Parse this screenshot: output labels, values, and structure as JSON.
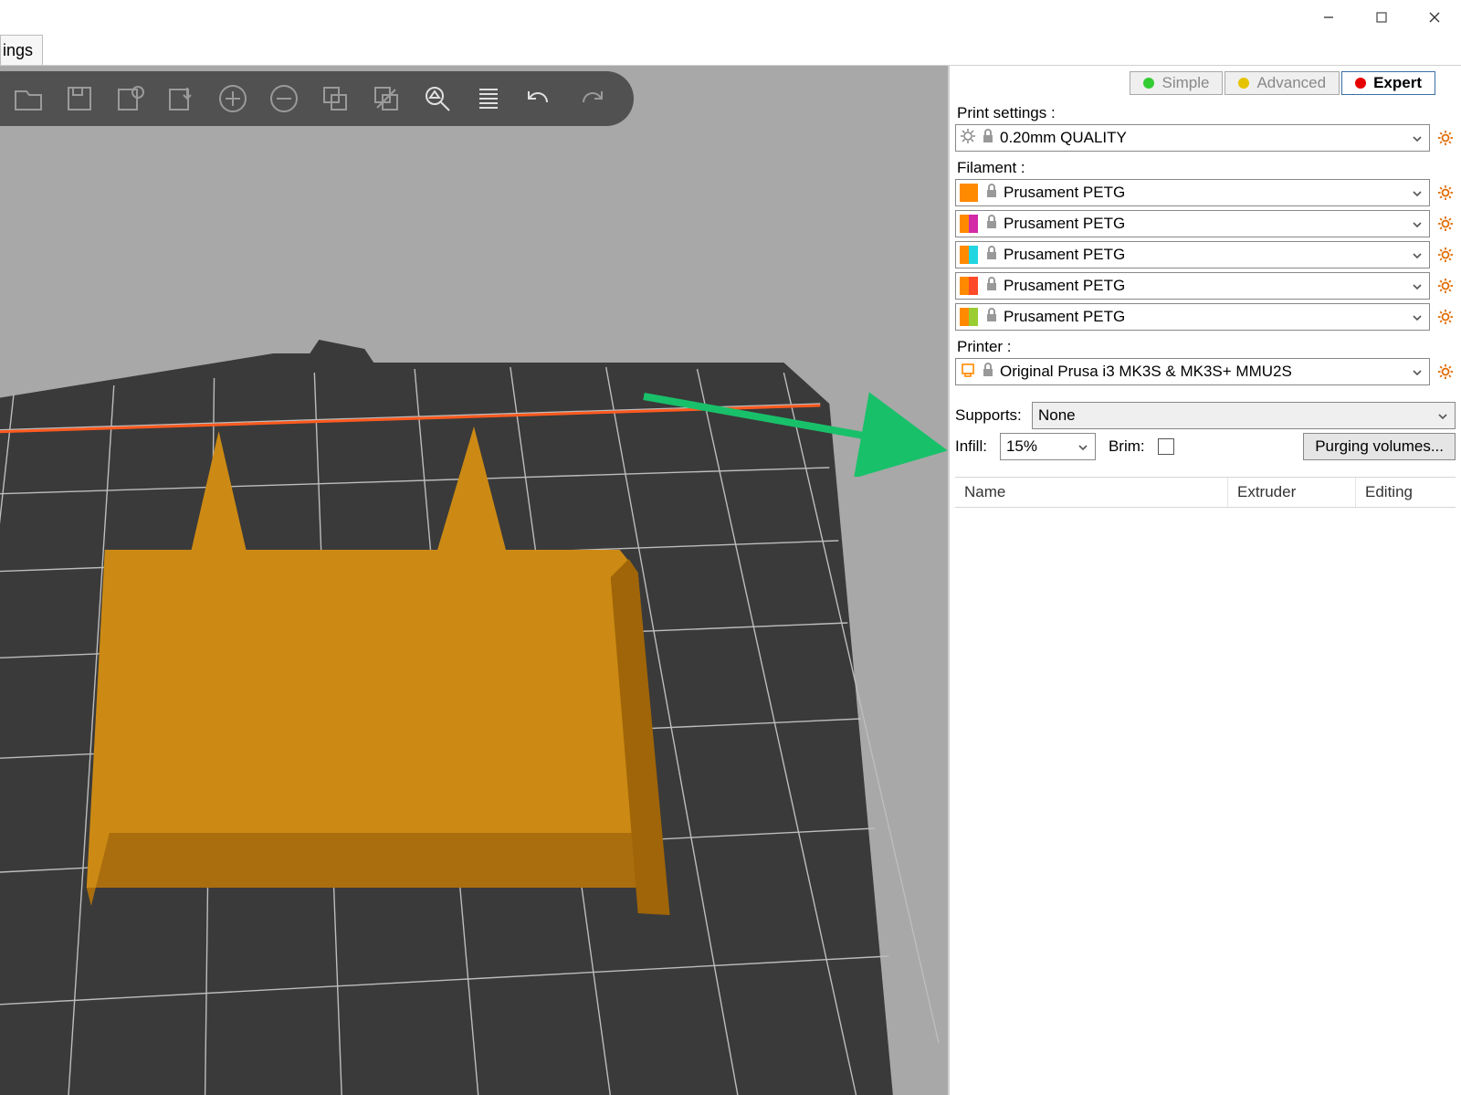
{
  "window": {
    "menu_fragment": "ings"
  },
  "modes": {
    "simple": "Simple",
    "advanced": "Advanced",
    "expert": "Expert",
    "active": "expert"
  },
  "panel": {
    "print_settings_label": "Print settings :",
    "print_settings_value": "0.20mm QUALITY",
    "filament_label": "Filament :",
    "filaments": [
      {
        "colors": [
          "#ff8a00",
          "#ff8a00"
        ],
        "name": "Prusament PETG"
      },
      {
        "colors": [
          "#ff8a00",
          "#d32aa8"
        ],
        "name": "Prusament PETG"
      },
      {
        "colors": [
          "#ff8a00",
          "#21d6e0"
        ],
        "name": "Prusament PETG"
      },
      {
        "colors": [
          "#ff8a00",
          "#ff4a2a"
        ],
        "name": "Prusament PETG"
      },
      {
        "colors": [
          "#ff8a00",
          "#9acd32"
        ],
        "name": "Prusament PETG"
      }
    ],
    "printer_label": "Printer :",
    "printer_value": "Original Prusa i3 MK3S & MK3S+ MMU2S",
    "supports_label": "Supports:",
    "supports_value": "None",
    "infill_label": "Infill:",
    "infill_value": "15%",
    "brim_label": "Brim:",
    "brim_checked": false,
    "purging_button": "Purging volumes...",
    "table": {
      "col_name": "Name",
      "col_extruder": "Extruder",
      "col_editing": "Editing"
    }
  },
  "mode_colors": {
    "simple": "#33cc33",
    "advanced": "#e6c300",
    "expert": "#e60000"
  }
}
